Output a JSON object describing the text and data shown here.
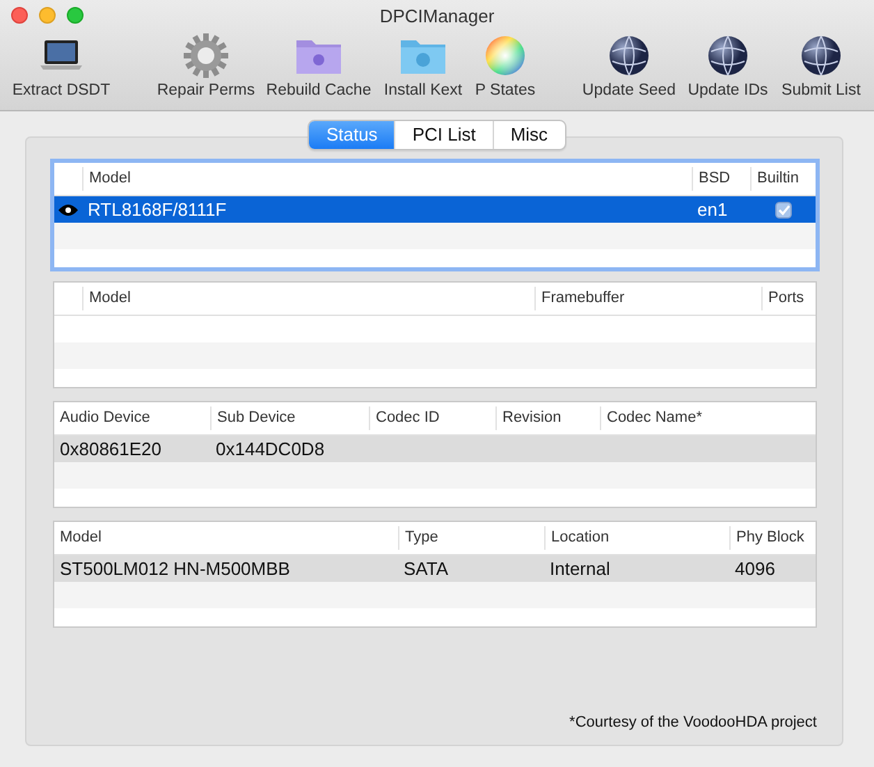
{
  "window": {
    "title": "DPCIManager"
  },
  "toolbar": [
    {
      "label": "Extract DSDT",
      "kind": "laptop"
    },
    {
      "label": "Repair Perms",
      "kind": "gear"
    },
    {
      "label": "Rebuild Cache",
      "kind": "folder-purple"
    },
    {
      "label": "Install Kext",
      "kind": "folder-blue"
    },
    {
      "label": "P States",
      "kind": "color-wheel"
    },
    {
      "label": "Update Seed",
      "kind": "globe"
    },
    {
      "label": "Update IDs",
      "kind": "globe"
    },
    {
      "label": "Submit List",
      "kind": "globe"
    }
  ],
  "tabs": [
    {
      "label": "Status",
      "selected": true
    },
    {
      "label": "PCI List",
      "selected": false
    },
    {
      "label": "Misc",
      "selected": false
    }
  ],
  "tables": [
    {
      "focused": true,
      "columns": [
        "Model",
        "BSD",
        "Builtin"
      ],
      "rows": [
        {
          "selected": true,
          "cells": [
            "RTL8168F/8111F",
            "en1"
          ],
          "checked": true
        }
      ]
    },
    {
      "focused": false,
      "columns": [
        "Model",
        "Framebuffer",
        "Ports"
      ]
    },
    {
      "focused": false,
      "columns": [
        "Audio Device",
        "Sub Device",
        "Codec ID",
        "Revision",
        "Codec Name*"
      ],
      "rows": [
        {
          "selected": true,
          "cells": [
            "0x80861E20",
            "0x144DC0D8"
          ]
        }
      ]
    },
    {
      "focused": false,
      "columns": [
        "Model",
        "Type",
        "Location",
        "Phy Block"
      ],
      "rows": [
        {
          "selected": true,
          "cells": [
            "ST500LM012 HN-M500MBB",
            "SATA",
            "Internal",
            "4096"
          ]
        }
      ]
    }
  ],
  "footnote": "*Courtesy of the VoodooHDA project"
}
